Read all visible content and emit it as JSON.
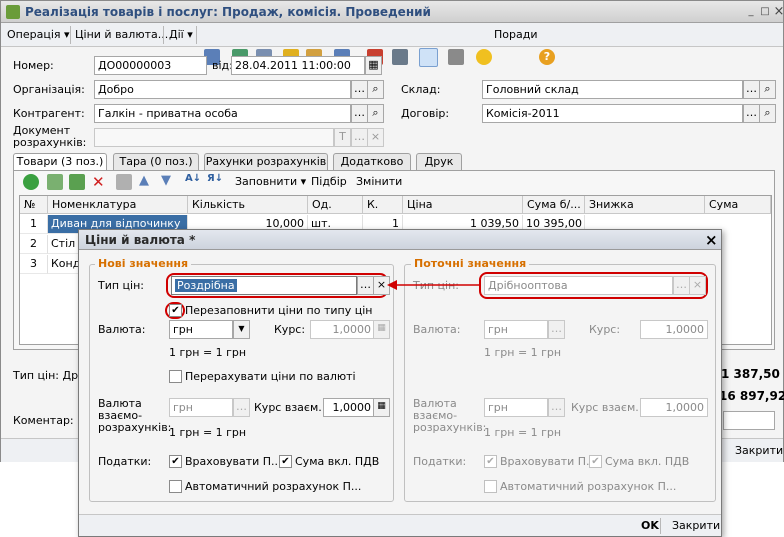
{
  "window": {
    "title": "Реалізація товарів і послуг: Продаж, комісія. Проведений",
    "min": "_",
    "max": "□",
    "close": "×"
  },
  "toolbar": {
    "operation": "Операція ▾",
    "prices_currency": "Ціни й валюта...",
    "actions": "Дії ▾",
    "payments": "Поради",
    "help": "?"
  },
  "header": {
    "number_label": "Номер:",
    "number_value": "ДО00000003",
    "date_label": "від:",
    "date_value": "28.04.2011 11:00:00",
    "org_label": "Організація:",
    "org_value": "Добро",
    "contractor_label": "Контрагент:",
    "contractor_value": "Галкін - приватна особа",
    "doc_label_1": "Документ",
    "doc_label_2": "розрахунків:",
    "warehouse_label": "Склад:",
    "warehouse_value": "Головний склад",
    "contract_label": "Договір:",
    "contract_value": "Комісія-2011"
  },
  "tabs": [
    {
      "label": "Товари (3 поз.)"
    },
    {
      "label": "Тара (0 поз.)"
    },
    {
      "label": "Рахунки розрахунків"
    },
    {
      "label": "Додатково"
    },
    {
      "label": "Друк"
    }
  ],
  "table_toolbar": {
    "fill": "Заповнити ▾",
    "selection": "Підбір",
    "change": "Змінити"
  },
  "table": {
    "columns": [
      "№",
      "Номенклатура",
      "Кількість",
      "Од.",
      "К.",
      "Ціна",
      "Сума б/...",
      "Знижка",
      "Сума"
    ],
    "rows": [
      {
        "n": "1",
        "name": "Диван для відпочинку",
        "qty": "10,000",
        "unit": "шт.",
        "k": "1",
        "price": "1 039,50",
        "sum": "10 395,00"
      },
      {
        "n": "2",
        "name": "Стіл п",
        "qty": "",
        "unit": "",
        "k": "",
        "price": "",
        "sum": ""
      },
      {
        "n": "3",
        "name": "Конд",
        "qty": "",
        "unit": "",
        "k": "",
        "price": "",
        "sum": ""
      }
    ]
  },
  "footer": {
    "price_type": "Тип цін: Дрі",
    "total1": "1 387,50",
    "total2": "16 897,92",
    "comment_label": "Коментар:",
    "close_btn": "Закрити"
  },
  "dialog": {
    "title": "Ціни й валюта *",
    "close": "×",
    "new": {
      "group_title": "Нові значення",
      "price_type_label": "Тип цін:",
      "price_type_value": "Роздрібна",
      "refill_label": "Перезаповнити ціни по типу цін",
      "currency_label": "Валюта:",
      "currency_value": "грн",
      "rate_label": "Курс:",
      "rate_value": "1,0000",
      "rate_text": "1 грн = 1 грн",
      "recalc_label": "Перерахувати ціни по валюті",
      "settle_label_1": "Валюта",
      "settle_label_2": "взаємо-",
      "settle_label_3": "розрахунків:",
      "settle_value": "грн",
      "settle_rate_label": "Курс взаєм.:",
      "settle_rate_value": "1,0000",
      "settle_rate_text": "1 грн = 1 грн",
      "taxes_label": "Податки:",
      "tax_include": "Враховувати П...",
      "sum_incl_vat": "Сума вкл. ПДВ",
      "auto_calc": "Автоматичний розрахунок П..."
    },
    "current": {
      "group_title": "Поточні значення",
      "price_type_label": "Тип цін:",
      "price_type_value": "Дрібнооптова",
      "currency_label": "Валюта:",
      "currency_value": "грн",
      "rate_label": "Курс:",
      "rate_value": "1,0000",
      "rate_text": "1 грн = 1 грн",
      "settle_label_1": "Валюта",
      "settle_label_2": "взаємо-",
      "settle_label_3": "розрахунків:",
      "settle_value": "грн",
      "settle_rate_label": "Курс взаєм.:",
      "settle_rate_value": "1,0000",
      "settle_rate_text": "1 грн = 1 грн",
      "taxes_label": "Податки:",
      "tax_include": "Враховувати П...",
      "sum_incl_vat": "Сума вкл. ПДВ",
      "auto_calc": "Автоматичний розрахунок П..."
    },
    "ok": "OK",
    "close_btn": "Закрити"
  }
}
